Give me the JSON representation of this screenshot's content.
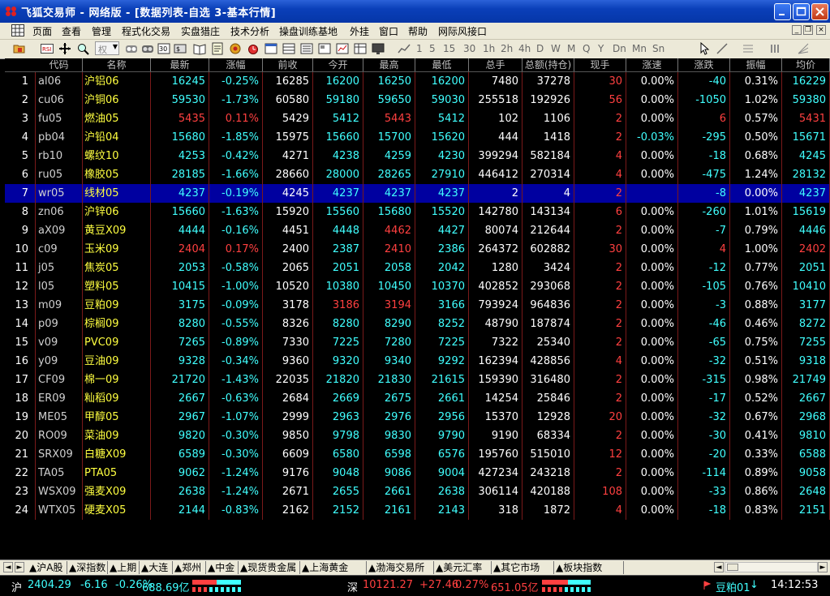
{
  "window": {
    "title": "飞狐交易师 - 网络版 - [数据列表-自选  3-基本行情]"
  },
  "menu": {
    "items": [
      "页面",
      "查看",
      "管理",
      "程式化交易",
      "实盘猎庄",
      "技术分析",
      "操盘训练基地",
      "外挂",
      "窗口",
      "帮助",
      "网际风接口"
    ]
  },
  "toolbar": {
    "periods": [
      "1",
      "5",
      "15",
      "30",
      "1h",
      "2h",
      "4h",
      "D",
      "W",
      "M",
      "Q",
      "Y",
      "Dn",
      "Mn",
      "Sn"
    ],
    "dropdown_placeholder": "权"
  },
  "table": {
    "columns": [
      "代码",
      "名称",
      "最新",
      "涨幅",
      "前收",
      "今开",
      "最高",
      "最低",
      "总手",
      "总额(持仓)",
      "现手",
      "涨速",
      "涨跌",
      "振幅",
      "均价"
    ],
    "rows": [
      {
        "idx": "1",
        "code": "al06",
        "name": "沪铝06",
        "last": "16245",
        "chg_pct": "-0.25%",
        "prev": "16285",
        "open": "16200",
        "high": "16250",
        "low": "16200",
        "vol": "7480",
        "oi": "37278",
        "cur": "30",
        "speed": "0.00%",
        "chg": "-40",
        "amp": "0.31%",
        "avg": "16229"
      },
      {
        "idx": "2",
        "code": "cu06",
        "name": "沪铜06",
        "last": "59530",
        "chg_pct": "-1.73%",
        "prev": "60580",
        "open": "59180",
        "high": "59650",
        "low": "59030",
        "vol": "255518",
        "oi": "192926",
        "cur": "56",
        "speed": "0.00%",
        "chg": "-1050",
        "amp": "1.02%",
        "avg": "59380"
      },
      {
        "idx": "3",
        "code": "fu05",
        "name": "燃油05",
        "last": "5435",
        "chg_pct": "0.11%",
        "prev": "5429",
        "open": "5412",
        "high": "5443",
        "low": "5412",
        "vol": "102",
        "oi": "1106",
        "cur": "2",
        "speed": "0.00%",
        "chg": "6",
        "amp": "0.57%",
        "avg": "5431"
      },
      {
        "idx": "4",
        "code": "pb04",
        "name": "沪铅04",
        "last": "15680",
        "chg_pct": "-1.85%",
        "prev": "15975",
        "open": "15660",
        "high": "15700",
        "low": "15620",
        "vol": "444",
        "oi": "1418",
        "cur": "2",
        "speed": "-0.03%",
        "chg": "-295",
        "amp": "0.50%",
        "avg": "15671"
      },
      {
        "idx": "5",
        "code": "rb10",
        "name": "螺纹10",
        "last": "4253",
        "chg_pct": "-0.42%",
        "prev": "4271",
        "open": "4238",
        "high": "4259",
        "low": "4230",
        "vol": "399294",
        "oi": "582184",
        "cur": "4",
        "speed": "0.00%",
        "chg": "-18",
        "amp": "0.68%",
        "avg": "4245"
      },
      {
        "idx": "6",
        "code": "ru05",
        "name": "橡胶05",
        "last": "28185",
        "chg_pct": "-1.66%",
        "prev": "28660",
        "open": "28000",
        "high": "28265",
        "low": "27910",
        "vol": "446412",
        "oi": "270314",
        "cur": "4",
        "speed": "0.00%",
        "chg": "-475",
        "amp": "1.24%",
        "avg": "28132"
      },
      {
        "idx": "7",
        "code": "wr05",
        "name": "线材05",
        "last": "4237",
        "chg_pct": "-0.19%",
        "prev": "4245",
        "open": "4237",
        "high": "4237",
        "low": "4237",
        "vol": "2",
        "oi": "4",
        "cur": "2",
        "speed": "",
        "chg": "-8",
        "amp": "0.00%",
        "avg": "4237"
      },
      {
        "idx": "8",
        "code": "zn06",
        "name": "沪锌06",
        "last": "15660",
        "chg_pct": "-1.63%",
        "prev": "15920",
        "open": "15560",
        "high": "15680",
        "low": "15520",
        "vol": "142780",
        "oi": "143134",
        "cur": "6",
        "speed": "0.00%",
        "chg": "-260",
        "amp": "1.01%",
        "avg": "15619"
      },
      {
        "idx": "9",
        "code": "aX09",
        "name": "黄豆X09",
        "last": "4444",
        "chg_pct": "-0.16%",
        "prev": "4451",
        "open": "4448",
        "high": "4462",
        "low": "4427",
        "vol": "80074",
        "oi": "212644",
        "cur": "2",
        "speed": "0.00%",
        "chg": "-7",
        "amp": "0.79%",
        "avg": "4446"
      },
      {
        "idx": "10",
        "code": "c09",
        "name": "玉米09",
        "last": "2404",
        "chg_pct": "0.17%",
        "prev": "2400",
        "open": "2387",
        "high": "2410",
        "low": "2386",
        "vol": "264372",
        "oi": "602882",
        "cur": "30",
        "speed": "0.00%",
        "chg": "4",
        "amp": "1.00%",
        "avg": "2402"
      },
      {
        "idx": "11",
        "code": "j05",
        "name": "焦炭05",
        "last": "2053",
        "chg_pct": "-0.58%",
        "prev": "2065",
        "open": "2051",
        "high": "2058",
        "low": "2042",
        "vol": "1280",
        "oi": "3424",
        "cur": "2",
        "speed": "0.00%",
        "chg": "-12",
        "amp": "0.77%",
        "avg": "2051"
      },
      {
        "idx": "12",
        "code": "l05",
        "name": "塑料05",
        "last": "10415",
        "chg_pct": "-1.00%",
        "prev": "10520",
        "open": "10380",
        "high": "10450",
        "low": "10370",
        "vol": "402852",
        "oi": "293068",
        "cur": "2",
        "speed": "0.00%",
        "chg": "-105",
        "amp": "0.76%",
        "avg": "10410"
      },
      {
        "idx": "13",
        "code": "m09",
        "name": "豆粕09",
        "last": "3175",
        "chg_pct": "-0.09%",
        "prev": "3178",
        "open": "3186",
        "high": "3194",
        "low": "3166",
        "vol": "793924",
        "oi": "964836",
        "cur": "2",
        "speed": "0.00%",
        "chg": "-3",
        "amp": "0.88%",
        "avg": "3177"
      },
      {
        "idx": "14",
        "code": "p09",
        "name": "棕榈09",
        "last": "8280",
        "chg_pct": "-0.55%",
        "prev": "8326",
        "open": "8280",
        "high": "8290",
        "low": "8252",
        "vol": "48790",
        "oi": "187874",
        "cur": "2",
        "speed": "0.00%",
        "chg": "-46",
        "amp": "0.46%",
        "avg": "8272"
      },
      {
        "idx": "15",
        "code": "v09",
        "name": "PVC09",
        "last": "7265",
        "chg_pct": "-0.89%",
        "prev": "7330",
        "open": "7225",
        "high": "7280",
        "low": "7225",
        "vol": "7322",
        "oi": "25340",
        "cur": "2",
        "speed": "0.00%",
        "chg": "-65",
        "amp": "0.75%",
        "avg": "7255"
      },
      {
        "idx": "16",
        "code": "y09",
        "name": "豆油09",
        "last": "9328",
        "chg_pct": "-0.34%",
        "prev": "9360",
        "open": "9320",
        "high": "9340",
        "low": "9292",
        "vol": "162394",
        "oi": "428856",
        "cur": "4",
        "speed": "0.00%",
        "chg": "-32",
        "amp": "0.51%",
        "avg": "9318"
      },
      {
        "idx": "17",
        "code": "CF09",
        "name": "棉一09",
        "last": "21720",
        "chg_pct": "-1.43%",
        "prev": "22035",
        "open": "21820",
        "high": "21830",
        "low": "21615",
        "vol": "159390",
        "oi": "316480",
        "cur": "2",
        "speed": "0.00%",
        "chg": "-315",
        "amp": "0.98%",
        "avg": "21749"
      },
      {
        "idx": "18",
        "code": "ER09",
        "name": "籼稻09",
        "last": "2667",
        "chg_pct": "-0.63%",
        "prev": "2684",
        "open": "2669",
        "high": "2675",
        "low": "2661",
        "vol": "14254",
        "oi": "25846",
        "cur": "2",
        "speed": "0.00%",
        "chg": "-17",
        "amp": "0.52%",
        "avg": "2667"
      },
      {
        "idx": "19",
        "code": "ME05",
        "name": "甲醇05",
        "last": "2967",
        "chg_pct": "-1.07%",
        "prev": "2999",
        "open": "2963",
        "high": "2976",
        "low": "2956",
        "vol": "15370",
        "oi": "12928",
        "cur": "20",
        "speed": "0.00%",
        "chg": "-32",
        "amp": "0.67%",
        "avg": "2968"
      },
      {
        "idx": "20",
        "code": "RO09",
        "name": "菜油09",
        "last": "9820",
        "chg_pct": "-0.30%",
        "prev": "9850",
        "open": "9798",
        "high": "9830",
        "low": "9790",
        "vol": "9190",
        "oi": "68334",
        "cur": "2",
        "speed": "0.00%",
        "chg": "-30",
        "amp": "0.41%",
        "avg": "9810"
      },
      {
        "idx": "21",
        "code": "SRX09",
        "name": "白糖X09",
        "last": "6589",
        "chg_pct": "-0.30%",
        "prev": "6609",
        "open": "6580",
        "high": "6598",
        "low": "6576",
        "vol": "195760",
        "oi": "515010",
        "cur": "12",
        "speed": "0.00%",
        "chg": "-20",
        "amp": "0.33%",
        "avg": "6588"
      },
      {
        "idx": "22",
        "code": "TA05",
        "name": "PTA05",
        "last": "9062",
        "chg_pct": "-1.24%",
        "prev": "9176",
        "open": "9048",
        "high": "9086",
        "low": "9004",
        "vol": "427234",
        "oi": "243218",
        "cur": "2",
        "speed": "0.00%",
        "chg": "-114",
        "amp": "0.89%",
        "avg": "9058"
      },
      {
        "idx": "23",
        "code": "WSX09",
        "name": "强麦X09",
        "last": "2638",
        "chg_pct": "-1.24%",
        "prev": "2671",
        "open": "2655",
        "high": "2661",
        "low": "2638",
        "vol": "306114",
        "oi": "420188",
        "cur": "108",
        "speed": "0.00%",
        "chg": "-33",
        "amp": "0.86%",
        "avg": "2648"
      },
      {
        "idx": "24",
        "code": "WTX05",
        "name": "硬麦X05",
        "last": "2144",
        "chg_pct": "-0.83%",
        "prev": "2162",
        "open": "2152",
        "high": "2161",
        "low": "2143",
        "vol": "318",
        "oi": "1872",
        "cur": "4",
        "speed": "0.00%",
        "chg": "-18",
        "amp": "0.83%",
        "avg": "2151"
      }
    ],
    "selected_row": 6
  },
  "tabs": [
    "▲沪A股",
    "▲深指数",
    "▲上期",
    "▲大连",
    "▲郑州",
    "▲中金",
    "▲现货贵金属",
    "▲上海黄金",
    "▲渤海交易所",
    "▲美元汇率",
    "▲其它市场",
    "▲板块指数"
  ],
  "status": {
    "sh_label": "沪",
    "sh_index": "2404.29",
    "sh_change": "-6.16",
    "sh_pct": "-0.26%",
    "sh_amount": "688.69亿",
    "sz_label": "深",
    "sz_index": "10121.27",
    "sz_change": "+27.46",
    "sz_pct": "0.27%",
    "sz_amount": "651.05亿",
    "current_symbol": "豆粕01",
    "time": "14:12:53"
  },
  "colors": {
    "up": "#ff4040",
    "down": "#40ffff",
    "flat": "#ffffff",
    "name_yellow": "#ffff40",
    "code_white": "#d0d0d0",
    "cur_red": "#ff4040",
    "selected_bg": "#0000a0"
  }
}
